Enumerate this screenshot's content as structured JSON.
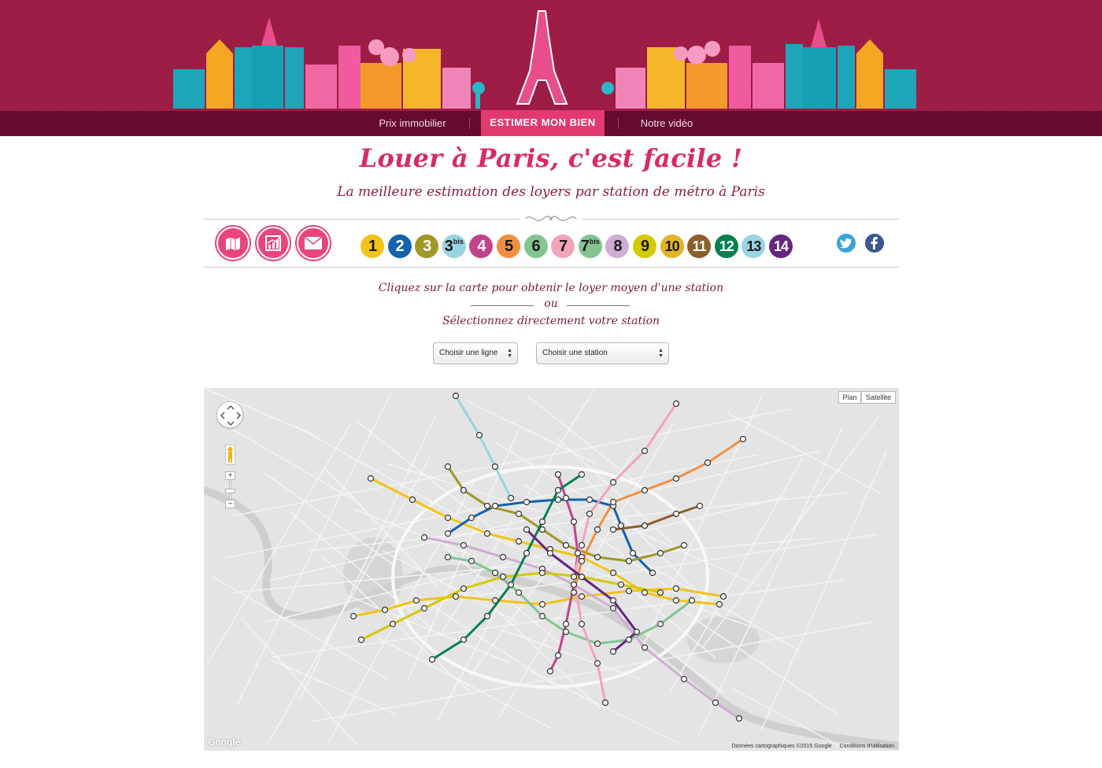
{
  "nav": {
    "items": [
      {
        "label": "Prix immobilier",
        "active": false
      },
      {
        "label": "ESTIMER MON BIEN",
        "active": true
      },
      {
        "label": "Notre vidéo",
        "active": false
      }
    ]
  },
  "header": {
    "title": "Louer à Paris, c'est facile !",
    "subtitle": "La meilleure estimation des loyers par station de métro à Paris"
  },
  "toolbar": {
    "icons": [
      "map-icon",
      "chart-icon",
      "mail-icon"
    ],
    "lines": [
      {
        "label": "1",
        "sup": "",
        "color": "#f2c318",
        "text": "#1a1a1a"
      },
      {
        "label": "2",
        "sup": "",
        "color": "#1262ae",
        "text": "#ffffff"
      },
      {
        "label": "3",
        "sup": "",
        "color": "#9f9825",
        "text": "#ffffff"
      },
      {
        "label": "3",
        "sup": "bis",
        "color": "#98d4e2",
        "text": "#1a1a1a"
      },
      {
        "label": "4",
        "sup": "",
        "color": "#c0448c",
        "text": "#ffffff"
      },
      {
        "label": "5",
        "sup": "",
        "color": "#f28e42",
        "text": "#1a1a1a"
      },
      {
        "label": "6",
        "sup": "",
        "color": "#83c491",
        "text": "#1a1a1a"
      },
      {
        "label": "7",
        "sup": "",
        "color": "#f3a4ba",
        "text": "#1a1a1a"
      },
      {
        "label": "7",
        "sup": "bis",
        "color": "#83c491",
        "text": "#1a1a1a"
      },
      {
        "label": "8",
        "sup": "",
        "color": "#ceadd2",
        "text": "#1a1a1a"
      },
      {
        "label": "9",
        "sup": "",
        "color": "#d5c900",
        "text": "#1a1a1a"
      },
      {
        "label": "10",
        "sup": "",
        "color": "#e3b32a",
        "text": "#1a1a1a"
      },
      {
        "label": "11",
        "sup": "",
        "color": "#8d5e2a",
        "text": "#ffffff"
      },
      {
        "label": "12",
        "sup": "",
        "color": "#00814f",
        "text": "#ffffff"
      },
      {
        "label": "13",
        "sup": "",
        "color": "#98d4e2",
        "text": "#1a1a1a"
      },
      {
        "label": "14",
        "sup": "",
        "color": "#662483",
        "text": "#ffffff"
      }
    ],
    "social": [
      "twitter-icon",
      "facebook-icon"
    ]
  },
  "instructions": {
    "line1": "Cliquez sur la carte pour obtenir le loyer moyen d'une station",
    "separator": "ou",
    "line2": "Sélectionnez directement votre station"
  },
  "selects": {
    "line_label": "Choisir une ligne",
    "station_label": "Choisir une station"
  },
  "map": {
    "type_buttons": [
      "Plan",
      "Satellite"
    ],
    "attribution": "Données cartographiques ©2015 Google",
    "terms": "Conditions d'utilisation",
    "logo": "Google",
    "zoom_in": "+",
    "zoom_out": "−"
  },
  "colors": {
    "brand": "#9b1b44",
    "nav": "#650b2e",
    "accent": "#e2396f",
    "title": "#d92a63"
  }
}
